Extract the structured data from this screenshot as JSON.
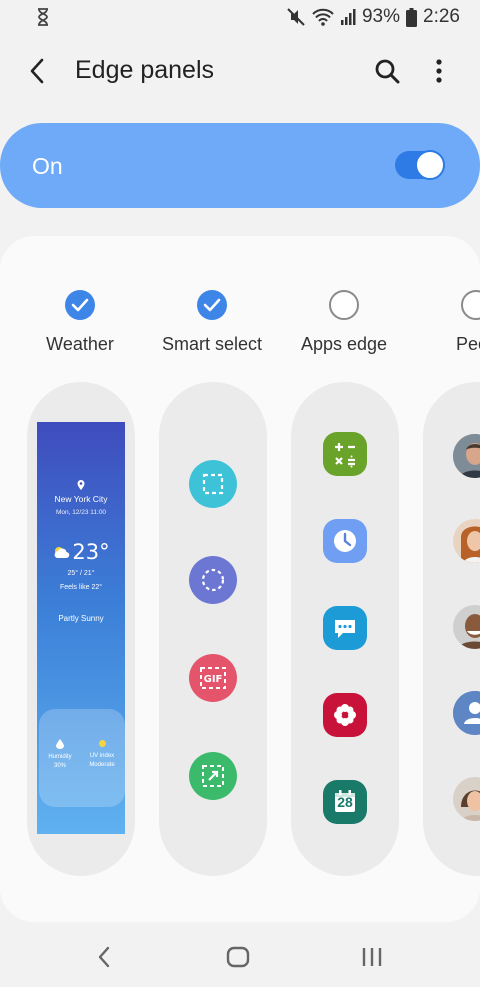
{
  "status_bar": {
    "left_icon": "hourglass-icon",
    "icons": [
      "mute-icon",
      "wifi-icon",
      "signal-icon"
    ],
    "battery": "93%",
    "time": "2:26"
  },
  "header": {
    "title": "Edge panels",
    "back_icon": "back-arrow-icon",
    "search_icon": "search-icon",
    "more_icon": "more-vertical-icon"
  },
  "master_switch": {
    "label": "On",
    "enabled": true
  },
  "colors": {
    "accent": "#3d86e8",
    "switch_bar": "#6eaaf7",
    "toggle_track": "#2e7be6"
  },
  "panels": [
    {
      "label": "Weather",
      "checked": true,
      "weather": {
        "city": "New York City",
        "date": "Mon, 12/23 11:00",
        "temp": "23°",
        "range": "25° / 21°",
        "feels": "Feels like 22°",
        "desc": "Partly Sunny",
        "humidity_label": "Humidity",
        "humidity_value": "30%",
        "uv_label": "UV index",
        "uv_value": "Moderate"
      }
    },
    {
      "label": "Smart select",
      "checked": true,
      "tools": [
        "rectangle-select-icon",
        "oval-select-icon",
        "animation-gif-icon",
        "pin-to-screen-icon"
      ]
    },
    {
      "label": "Apps edge",
      "checked": false,
      "apps": [
        "calculator-icon",
        "clock-icon",
        "messages-icon",
        "gallery-icon",
        "calendar-icon"
      ],
      "calendar_day": "28"
    },
    {
      "label": "People",
      "checked": false,
      "contacts": [
        "contact-avatar-1",
        "contact-avatar-2",
        "contact-avatar-3",
        "contact-avatar-generic",
        "contact-avatar-5"
      ]
    }
  ],
  "nav_bar": {
    "buttons": [
      "nav-back-icon",
      "nav-home-icon",
      "nav-recents-icon"
    ]
  }
}
